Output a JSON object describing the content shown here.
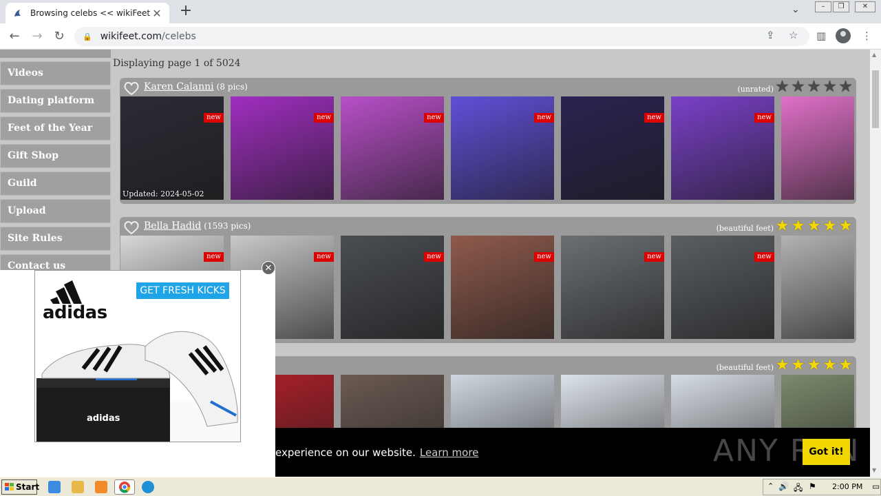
{
  "browser": {
    "tab_title": "Browsing celebs << wikiFeet",
    "url_host": "wikifeet.com",
    "url_path": "/celebs"
  },
  "sidebar": {
    "items": [
      {
        "label": "Videos"
      },
      {
        "label": "Dating platform"
      },
      {
        "label": "Feet of the Year"
      },
      {
        "label": "Gift Shop"
      },
      {
        "label": "Guild"
      },
      {
        "label": "Upload"
      },
      {
        "label": "Site Rules"
      },
      {
        "label": "Contact us"
      }
    ]
  },
  "main": {
    "page_count": "Displaying page 1 of 5024",
    "celebs": [
      {
        "name": "Karen Calanni",
        "pics": "(8 pics)",
        "rating_label": "(unrated)",
        "stars_filled": 0,
        "updated": "Updated: 2024-05-02",
        "new_badge": "new",
        "photo_colors": [
          "#2b2b35",
          "#a02ec0",
          "#b84fc8",
          "#6050d8",
          "#2a2250",
          "#7a40c8",
          "#e070c8"
        ]
      },
      {
        "name": "Bella Hadid",
        "pics": "(1593 pics)",
        "rating_label": "(beautiful feet)",
        "stars_filled": 5,
        "new_badge": "new",
        "photo_colors": [
          "#d8d8d8",
          "#c9c9c9",
          "#4a4d52",
          "#8f5a4c",
          "#6b6f74",
          "#5a5e63",
          "#b3b3b3"
        ]
      },
      {
        "name": "",
        "pics": "",
        "rating_label": "(beautiful feet)",
        "stars_filled": 5,
        "photo_colors": [
          "#b0202a",
          "#b0202a",
          "#6a5a52",
          "#cfd7e0",
          "#dce3ea",
          "#d6dde4",
          "#7c8a6c"
        ]
      }
    ]
  },
  "ad": {
    "brand": "adidas",
    "cta": "GET FRESH KICKS",
    "close_glyph": "✕",
    "cta_color": "#1fa4e8"
  },
  "cookie": {
    "message": "experience on our website.",
    "learn_more": "Learn more",
    "accept": "Got it!",
    "accept_color": "#f1d600"
  },
  "watermark": "ANY RUN",
  "taskbar": {
    "start_label": "Start",
    "clock": "2:00 PM"
  }
}
